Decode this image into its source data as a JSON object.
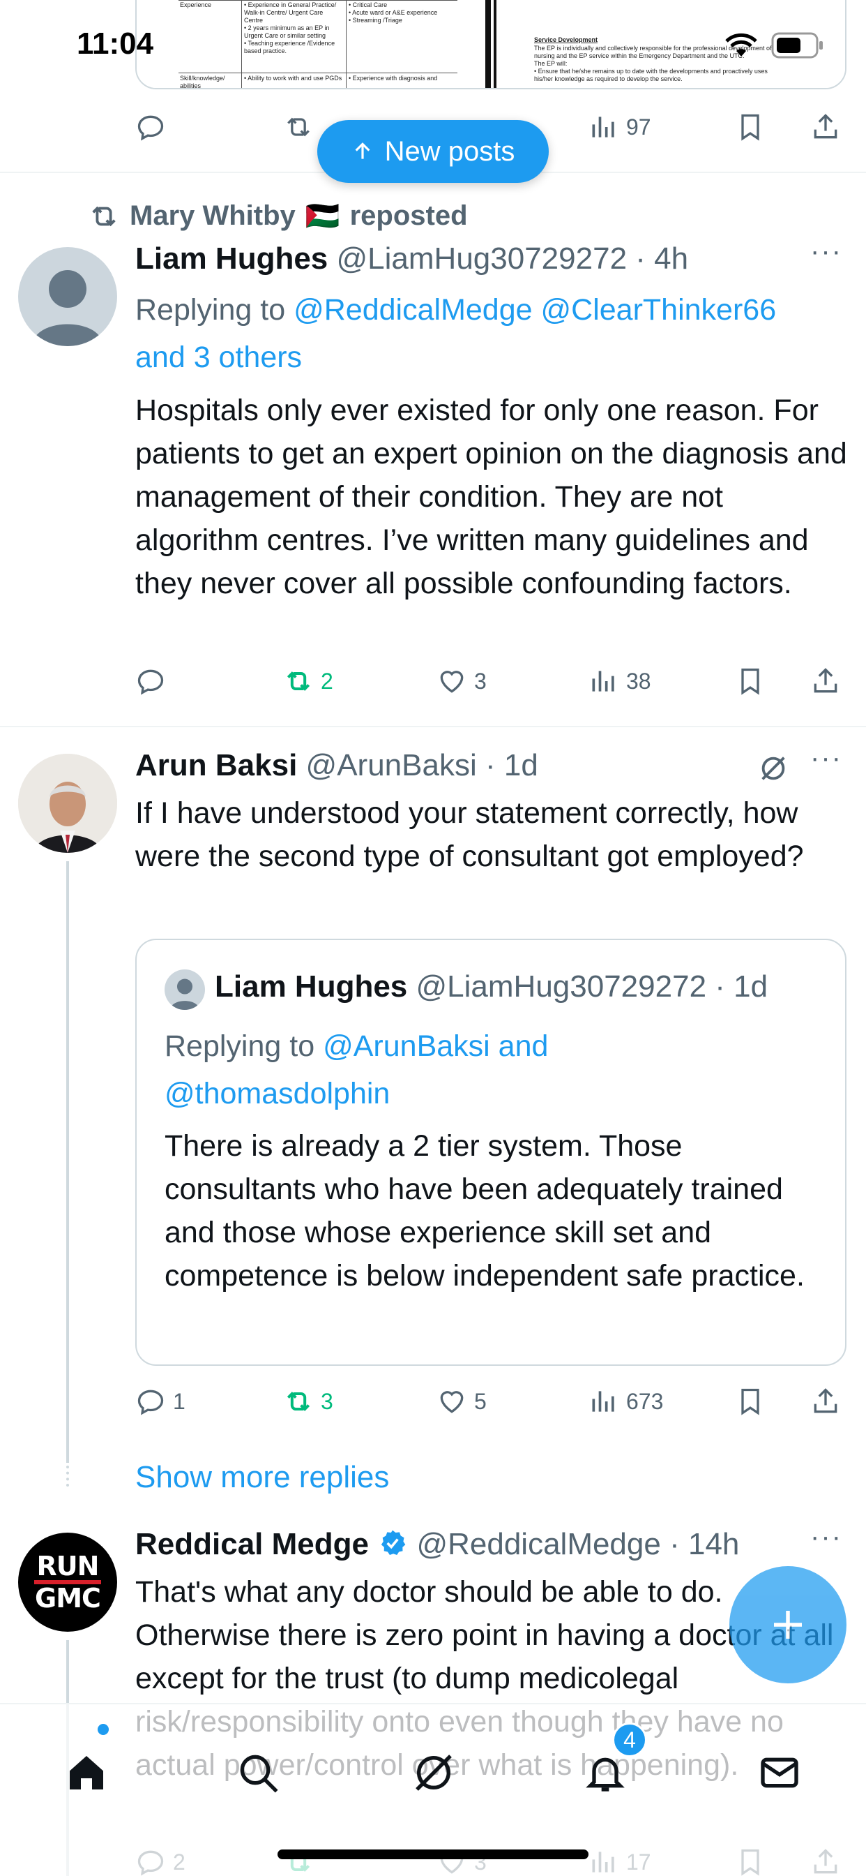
{
  "status_bar": {
    "time": "11:04"
  },
  "top_post": {
    "image_doc": {
      "row1_label": "Experience",
      "row1_col1": "• Experience in General Practice/ Walk-in Centre/ Urgent Care Centre\n• 2 years minimum as an EP in Urgent Care or similar setting\n• Teaching experience /Evidence based practice.",
      "row1_col2": "• Critical Care\n• Acute ward or A&E experience\n• Streaming /Triage",
      "row2_label": "Skill/knowledge/ abilities",
      "row2_col1": "• Ability to work with and use PGDs",
      "row2_col2": "• Experience with diagnosis and",
      "right_heading": "Service Development",
      "right_text": "The EP is individually and collectively responsible for the professional development of nursing and the EP service within the Emergency Department and the UTC.\nThe EP will:\n• Ensure that he/she remains up to date with the developments and proactively uses his/her knowledge as required to develop the service."
    },
    "views": "97"
  },
  "new_posts_label": "New posts",
  "repost_line": {
    "user": "Mary Whitby",
    "flag": "🇵🇸",
    "suffix": "reposted"
  },
  "post1": {
    "name": "Liam Hughes",
    "handle": "@LiamHug30729272",
    "time": "· 4h",
    "replying_label": "Replying to",
    "replying_handles": "@ReddicalMedge @ClearThinker66",
    "replying_more": "and 3 others",
    "text": "Hospitals only ever existed for only one reason. For patients to get an expert opinion on the diagnosis and management of their condition. They are not algorithm centres. I’ve written many guidelines and they never cover all possible confounding factors.",
    "reposts": "2",
    "likes": "3",
    "views": "38"
  },
  "post2": {
    "name": "Arun Baksi",
    "handle": "@ArunBaksi",
    "time": "· 1d",
    "text": "If I have understood your statement correctly, how were the second type of consultant got employed?",
    "quote": {
      "name": "Liam Hughes",
      "handle": "@LiamHug30729272",
      "time": "· 1d",
      "replying_label": "Replying to",
      "replying_a": "@ArunBaksi and",
      "replying_b": "@thomasdolphin",
      "text": "There is already a 2 tier system. Those consultants who have been adequately trained and those whose experience skill set and competence is below independent safe practice."
    },
    "replies": "1",
    "reposts": "3",
    "likes": "5",
    "views": "673"
  },
  "show_more_replies": "Show more replies",
  "post3": {
    "name": "Reddical Medge",
    "handle": "@ReddicalMedge",
    "time": "· 14h",
    "avatar_text_1": "RUN",
    "avatar_text_2": "GMC",
    "text": "That's what any doctor should be able to do. Otherwise there is zero point in having a doctor at all except for the trust (to dump medicolegal risk/responsibility onto even though they have no actual power/control over what is happening).",
    "replies": "2",
    "reposts": "",
    "likes": "3",
    "views": "17"
  },
  "bottom_nav": {
    "notifications_badge": "4"
  },
  "colors": {
    "accent": "#1d9bf0",
    "repost_green": "#00ba7c",
    "muted": "#536471",
    "text": "#0f1419"
  }
}
